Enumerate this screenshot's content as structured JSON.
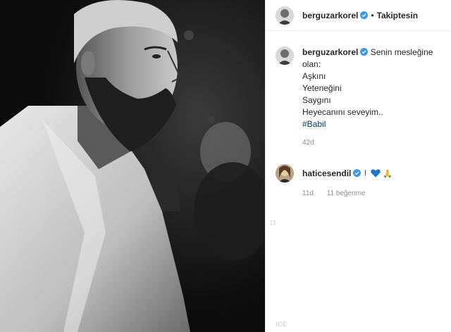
{
  "post": {
    "author": {
      "username": "berguzarkorel",
      "verified": true,
      "follow_status": "Takiptesin",
      "separator": "•"
    },
    "caption": {
      "username": "berguzarkorel",
      "lines": [
        "Senin mesleğine olan:",
        "Aşkını",
        "Yeteneğini",
        "Saygını",
        "Heyecanını seveyim.."
      ],
      "hashtag": "#Babil",
      "age": "42d"
    },
    "comments": [
      {
        "username": "haticesendil",
        "verified": true,
        "text": "🙏",
        "age": "11d",
        "likes": "11 beğenme"
      }
    ],
    "footer_text": "ICE"
  },
  "colors": {
    "link": "#00376b",
    "verified": "#3897f0",
    "muted": "#8e8e8e",
    "heart": "#1b75d3"
  }
}
